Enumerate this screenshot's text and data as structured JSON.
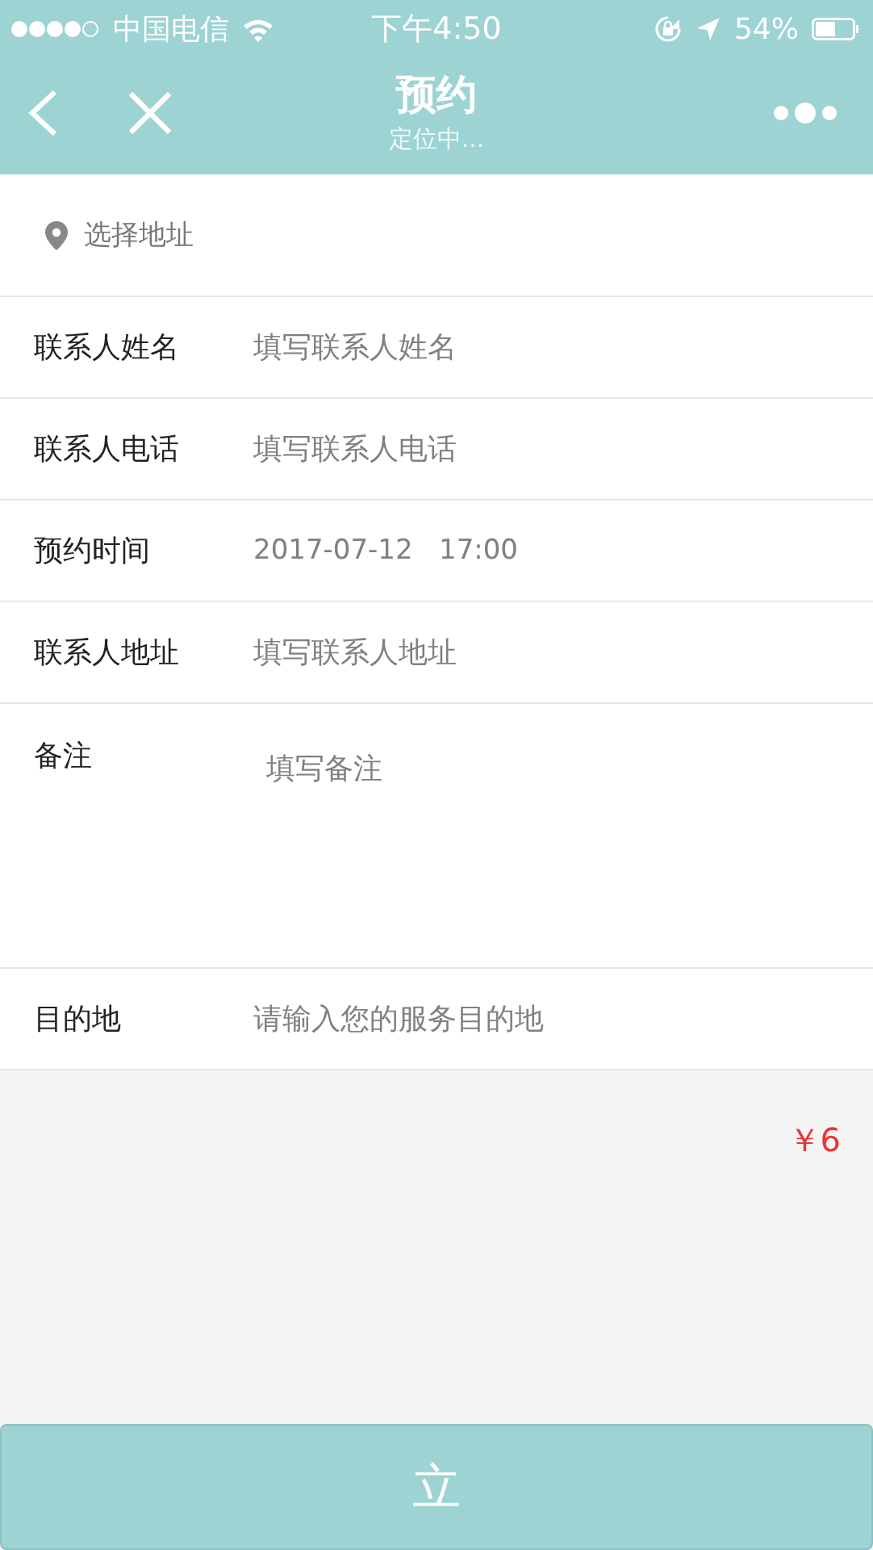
{
  "status_bar": {
    "carrier": "中国电信",
    "time": "下午4:50",
    "battery": "54%"
  },
  "nav_bar": {
    "title": "预约",
    "subtitle": "定位中..."
  },
  "address_picker": {
    "label": "选择地址"
  },
  "form": [
    {
      "kind": "input",
      "label": "联系人姓名",
      "placeholder": "填写联系人姓名"
    },
    {
      "kind": "input",
      "label": "联系人电话",
      "placeholder": "填写联系人电话"
    },
    {
      "kind": "value",
      "label": "预约时间",
      "value": "2017-07-12   17:00"
    },
    {
      "kind": "input",
      "label": "联系人地址",
      "placeholder": "填写联系人地址"
    },
    {
      "kind": "textarea",
      "label": "备注",
      "placeholder": "填写备注"
    },
    {
      "kind": "input",
      "label": "目的地",
      "placeholder": "请输入您的服务目的地"
    }
  ],
  "price": "￥6",
  "submit_button": "立"
}
